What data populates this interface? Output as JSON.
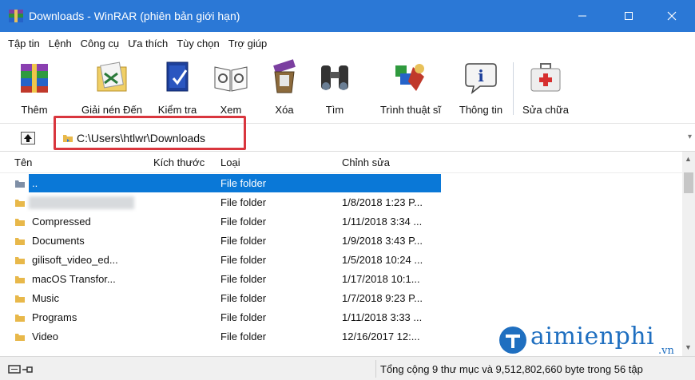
{
  "window": {
    "title": "Downloads - WinRAR (phiên bản giới hạn)",
    "controls": {
      "minimize": "—",
      "maximize": "☐",
      "close": "✕"
    },
    "accent": "#2b78d6"
  },
  "menu": [
    "Tập tin",
    "Lệnh",
    "Công cụ",
    "Ưa thích",
    "Tùy chọn",
    "Trợ giúp"
  ],
  "toolbar": [
    {
      "label": "Thêm",
      "icon": "add-archive-icon"
    },
    {
      "label": "Giải nén Đến",
      "icon": "extract-to-icon"
    },
    {
      "label": "Kiểm tra",
      "icon": "test-archive-icon"
    },
    {
      "label": "Xem",
      "icon": "view-book-icon"
    },
    {
      "label": "Xóa",
      "icon": "delete-bin-icon"
    },
    {
      "label": "Tìm",
      "icon": "find-binoculars-icon"
    },
    {
      "label": "Trình thuật sĩ",
      "icon": "wizard-icon"
    },
    {
      "label": "Thông tin",
      "icon": "info-icon"
    },
    {
      "label": "Sửa chữa",
      "icon": "repair-kit-icon"
    }
  ],
  "address": {
    "path": "C:\\Users\\htlwr\\Downloads",
    "highlight_color": "#d9363e"
  },
  "columns": [
    "Tên",
    "Kích thước",
    "Loại",
    "Chỉnh sửa"
  ],
  "rows": [
    {
      "name": "..",
      "size": "",
      "type": "File folder",
      "modified": "",
      "selected": true
    },
    {
      "name": "",
      "size": "",
      "type": "File folder",
      "modified": "1/8/2018 1:23 P...",
      "blurred": true
    },
    {
      "name": "Compressed",
      "size": "",
      "type": "File folder",
      "modified": "1/11/2018 3:34 ..."
    },
    {
      "name": "Documents",
      "size": "",
      "type": "File folder",
      "modified": "1/9/2018 3:43 P..."
    },
    {
      "name": "gilisoft_video_ed...",
      "size": "",
      "type": "File folder",
      "modified": "1/5/2018 10:24 ..."
    },
    {
      "name": "macOS Transfor...",
      "size": "",
      "type": "File folder",
      "modified": "1/17/2018 10:1..."
    },
    {
      "name": "Music",
      "size": "",
      "type": "File folder",
      "modified": "1/7/2018 9:23 P..."
    },
    {
      "name": "Programs",
      "size": "",
      "type": "File folder",
      "modified": "1/11/2018 3:33 ..."
    },
    {
      "name": "Video",
      "size": "",
      "type": "File folder",
      "modified": "12/16/2017 12:..."
    }
  ],
  "selection_color": "#0a78d7",
  "watermark": {
    "text": "aimienphi",
    "sub": ".vn"
  },
  "status": {
    "text": "Tổng cộng 9 thư mục và 9,512,802,660 byte trong 56 tập"
  }
}
